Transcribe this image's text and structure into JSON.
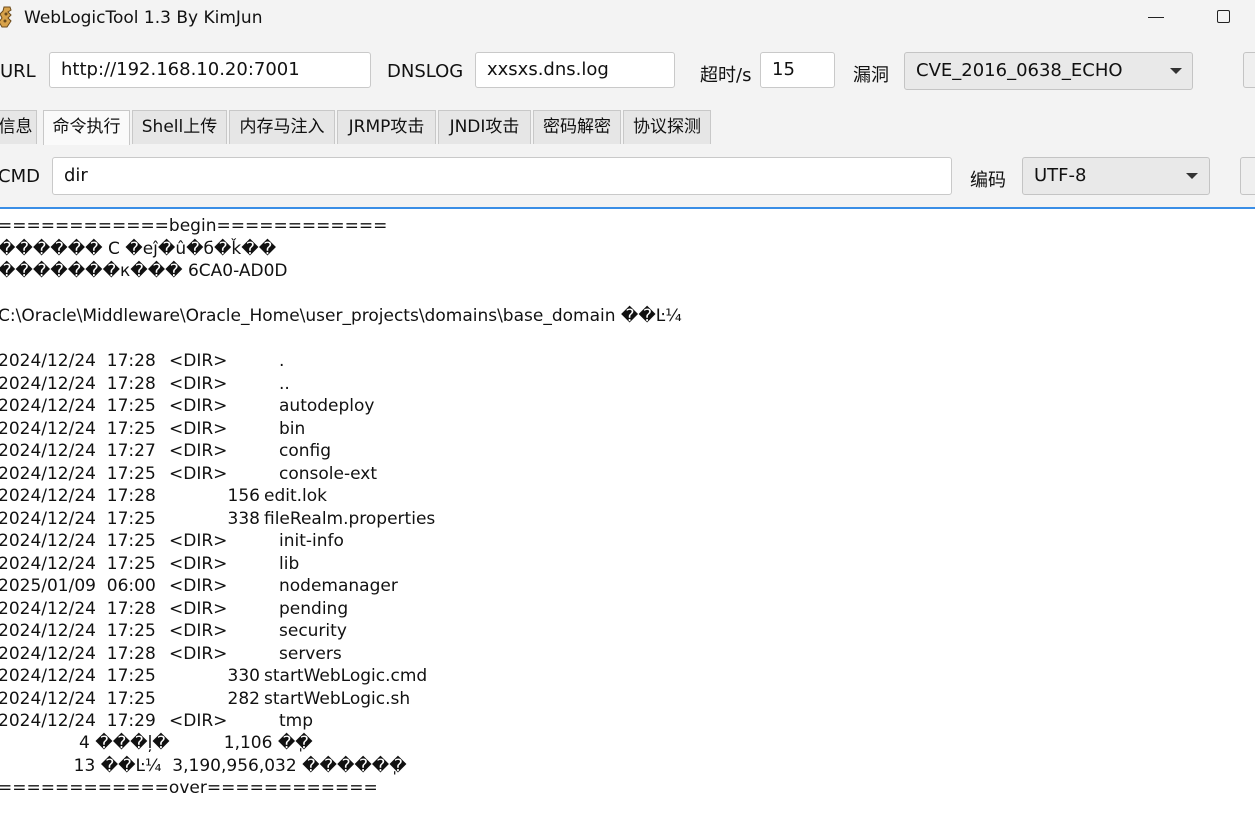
{
  "window": {
    "title": "WebLogicTool 1.3 By KimJun",
    "minimize_glyph": "—",
    "maximize_glyph": "☐"
  },
  "toolbar": {
    "url_label": "URL",
    "url_value": "http://192.168.10.20:7001",
    "dnslog_label": "DNSLOG",
    "dnslog_value": "xxsxs.dns.log",
    "timeout_label": "超时/s",
    "timeout_value": "15",
    "vuln_label": "漏洞",
    "vuln_selected": "CVE_2016_0638_ECHO"
  },
  "tabs": [
    {
      "label": "信息",
      "active": false
    },
    {
      "label": "命令执行",
      "active": true
    },
    {
      "label": "Shell上传",
      "active": false
    },
    {
      "label": "内存马注入",
      "active": false
    },
    {
      "label": "JRMP攻击",
      "active": false
    },
    {
      "label": "JNDI攻击",
      "active": false
    },
    {
      "label": "密码解密",
      "active": false
    },
    {
      "label": "协议探测",
      "active": false
    }
  ],
  "cmd": {
    "label": "CMD",
    "value": "dir",
    "encoding_label": "编码",
    "encoding_selected": "UTF-8"
  },
  "output": {
    "begin": "============begin============",
    "garbled1": "������ C �еĵ�û�б�ǩ��",
    "garbled2": "�������к��� 6CA0-AD0D",
    "dir_header": "C:\\Oracle\\Middleware\\Oracle_Home\\user_projects\\domains\\base_domain ��Ŀ¼",
    "entries": [
      {
        "date": "2024/12/24  17:28",
        "type": "<DIR>",
        "size": "",
        "name": "."
      },
      {
        "date": "2024/12/24  17:28",
        "type": "<DIR>",
        "size": "",
        "name": ".."
      },
      {
        "date": "2024/12/24  17:25",
        "type": "<DIR>",
        "size": "",
        "name": "autodeploy"
      },
      {
        "date": "2024/12/24  17:25",
        "type": "<DIR>",
        "size": "",
        "name": "bin"
      },
      {
        "date": "2024/12/24  17:27",
        "type": "<DIR>",
        "size": "",
        "name": "config"
      },
      {
        "date": "2024/12/24  17:25",
        "type": "<DIR>",
        "size": "",
        "name": "console-ext"
      },
      {
        "date": "2024/12/24  17:28",
        "type": "",
        "size": "156",
        "name": "edit.lok"
      },
      {
        "date": "2024/12/24  17:25",
        "type": "",
        "size": "338",
        "name": "fileRealm.properties"
      },
      {
        "date": "2024/12/24  17:25",
        "type": "<DIR>",
        "size": "",
        "name": "init-info"
      },
      {
        "date": "2024/12/24  17:25",
        "type": "<DIR>",
        "size": "",
        "name": "lib"
      },
      {
        "date": "2025/01/09  06:00",
        "type": "<DIR>",
        "size": "",
        "name": "nodemanager"
      },
      {
        "date": "2024/12/24  17:28",
        "type": "<DIR>",
        "size": "",
        "name": "pending"
      },
      {
        "date": "2024/12/24  17:25",
        "type": "<DIR>",
        "size": "",
        "name": "security"
      },
      {
        "date": "2024/12/24  17:28",
        "type": "<DIR>",
        "size": "",
        "name": "servers"
      },
      {
        "date": "2024/12/24  17:25",
        "type": "",
        "size": "330",
        "name": "startWebLogic.cmd"
      },
      {
        "date": "2024/12/24  17:25",
        "type": "",
        "size": "282",
        "name": "startWebLogic.sh"
      },
      {
        "date": "2024/12/24  17:29",
        "type": "<DIR>",
        "size": "",
        "name": "tmp"
      }
    ],
    "summary1": "               4 ���ļ�          1,106 �ֽ�",
    "summary2": "              13 ��Ŀ¼  3,190,956,032 �����ֽ�",
    "over": "============over============"
  }
}
